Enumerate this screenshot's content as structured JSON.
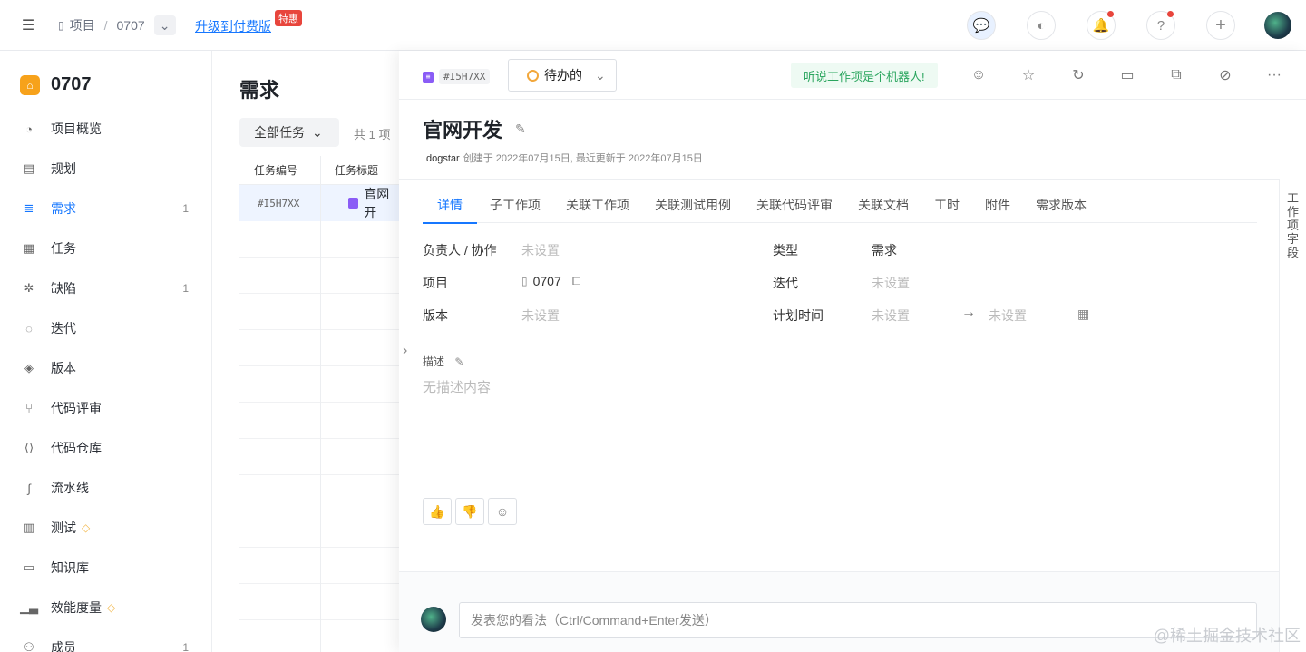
{
  "topbar": {
    "breadcrumb_project": "项目",
    "breadcrumb_sep": "/",
    "breadcrumb_current": "0707",
    "upgrade_label": "升级到付费版",
    "upgrade_badge": "特惠"
  },
  "sidebar": {
    "project_name": "0707",
    "items": [
      {
        "label": "项目概览",
        "icon": "gauge-icon",
        "count": ""
      },
      {
        "label": "规划",
        "icon": "doc-icon",
        "count": ""
      },
      {
        "label": "需求",
        "icon": "list-icon",
        "count": "1"
      },
      {
        "label": "任务",
        "icon": "task-icon",
        "count": ""
      },
      {
        "label": "缺陷",
        "icon": "bug-icon",
        "count": "1"
      },
      {
        "label": "迭代",
        "icon": "cycle-icon",
        "count": ""
      },
      {
        "label": "版本",
        "icon": "layers-icon",
        "count": ""
      },
      {
        "label": "代码评审",
        "icon": "branch-icon",
        "count": ""
      },
      {
        "label": "代码仓库",
        "icon": "code-icon",
        "count": ""
      },
      {
        "label": "流水线",
        "icon": "pipeline-icon",
        "count": ""
      },
      {
        "label": "测试",
        "icon": "test-icon",
        "count": ""
      },
      {
        "label": "知识库",
        "icon": "book-icon",
        "count": ""
      },
      {
        "label": "效能度量",
        "icon": "chart-icon",
        "count": ""
      },
      {
        "label": "成员",
        "icon": "members-icon",
        "count": "1"
      }
    ]
  },
  "list": {
    "title": "需求",
    "filter_label": "全部任务",
    "count_label": "共 1 项",
    "col_id": "任务编号",
    "col_title": "任务标题",
    "row_id": "#I5H7XX",
    "row_title": "官网开"
  },
  "panel": {
    "id_tag": "#I5H7XX",
    "status": "待办的",
    "robot_note": "听说工作项是个机器人!",
    "title": "官网开发",
    "meta_user": "dogstar",
    "meta_text": "创建于 2022年07月15日, 最近更新于 2022年07月15日",
    "side_label": "工作项字段",
    "tabs": [
      "详情",
      "子工作项",
      "关联工作项",
      "关联测试用例",
      "关联代码评审",
      "关联文档",
      "工时",
      "附件",
      "需求版本"
    ],
    "fields": {
      "owner_label": "负责人 / 协作",
      "owner_value": "未设置",
      "project_label": "项目",
      "project_value": "0707",
      "version_label": "版本",
      "version_value": "未设置",
      "type_label": "类型",
      "type_value": "需求",
      "iteration_label": "迭代",
      "iteration_value": "未设置",
      "plan_label": "计划时间",
      "plan_start": "未设置",
      "plan_end": "未设置"
    },
    "desc_label": "描述",
    "desc_empty": "无描述内容",
    "comment_placeholder": "发表您的看法（Ctrl/Command+Enter发送）"
  },
  "site_watermark": "@稀土掘金技术社区"
}
